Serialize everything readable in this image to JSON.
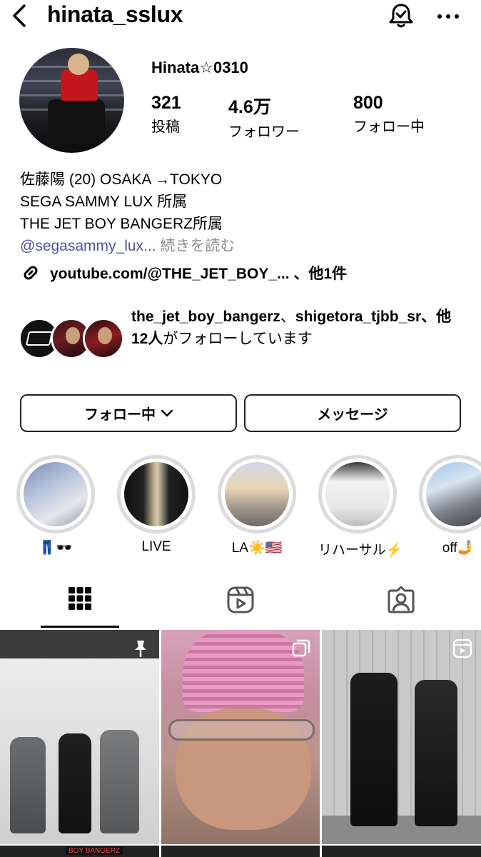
{
  "header": {
    "username": "hinata_sslux"
  },
  "profile": {
    "display_name": "Hinata☆0310",
    "stats": [
      {
        "value": "321",
        "label": "投稿"
      },
      {
        "value": "4.6万",
        "label": "フォロワー"
      },
      {
        "value": "800",
        "label": "フォロー中"
      }
    ],
    "bio_lines": [
      "佐藤陽 (20) OSAKA →TOKYO",
      "SEGA SAMMY LUX 所属",
      "THE JET BOY BANGERZ所属"
    ],
    "mention": "@segasammy_lux...",
    "more": "続きを読む",
    "link": "youtube.com/@THE_JET_BOY_... 、他1件"
  },
  "followed_by": {
    "account1": "the_jet_boy_bangerz",
    "sep": "、",
    "account2": "shigetora_tjbb_sr",
    "others": "、他12人",
    "suffix": "がフォローしています"
  },
  "buttons": {
    "follow": "フォロー中",
    "message": "メッセージ"
  },
  "highlights": [
    {
      "label": "👖🕶️"
    },
    {
      "label": "LIVE"
    },
    {
      "label": "LA☀️🇺🇸"
    },
    {
      "label": "リハーサル⚡️"
    },
    {
      "label": "off🤳"
    }
  ],
  "posts_row2_label": "BOY BANGERZ",
  "colors": {
    "mention": "#4b52a8",
    "ring": "#dbdbdb",
    "secondary": "#8e8e8e"
  }
}
